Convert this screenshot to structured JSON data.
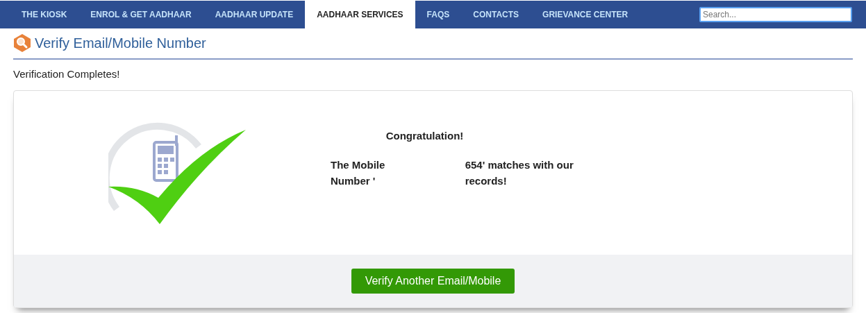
{
  "nav": {
    "tabs": [
      {
        "label": "THE KIOSK",
        "selected": false
      },
      {
        "label": "ENROL & GET AADHAAR",
        "selected": false
      },
      {
        "label": "AADHAAR UPDATE",
        "selected": false
      },
      {
        "label": "AADHAAR SERVICES",
        "selected": true
      },
      {
        "label": "FAQS",
        "selected": false
      },
      {
        "label": "CONTACTS",
        "selected": false
      },
      {
        "label": "GRIEVANCE CENTER",
        "selected": false
      }
    ],
    "search": {
      "placeholder": "Search..."
    }
  },
  "page": {
    "title": "Verify Email/Mobile Number",
    "status": "Verification Completes!"
  },
  "result": {
    "heading": "Congratulation!",
    "message_before": "The Mobile Number '",
    "message_after": "654' matches with our records!",
    "button": "Verify Another Email/Mobile"
  }
}
